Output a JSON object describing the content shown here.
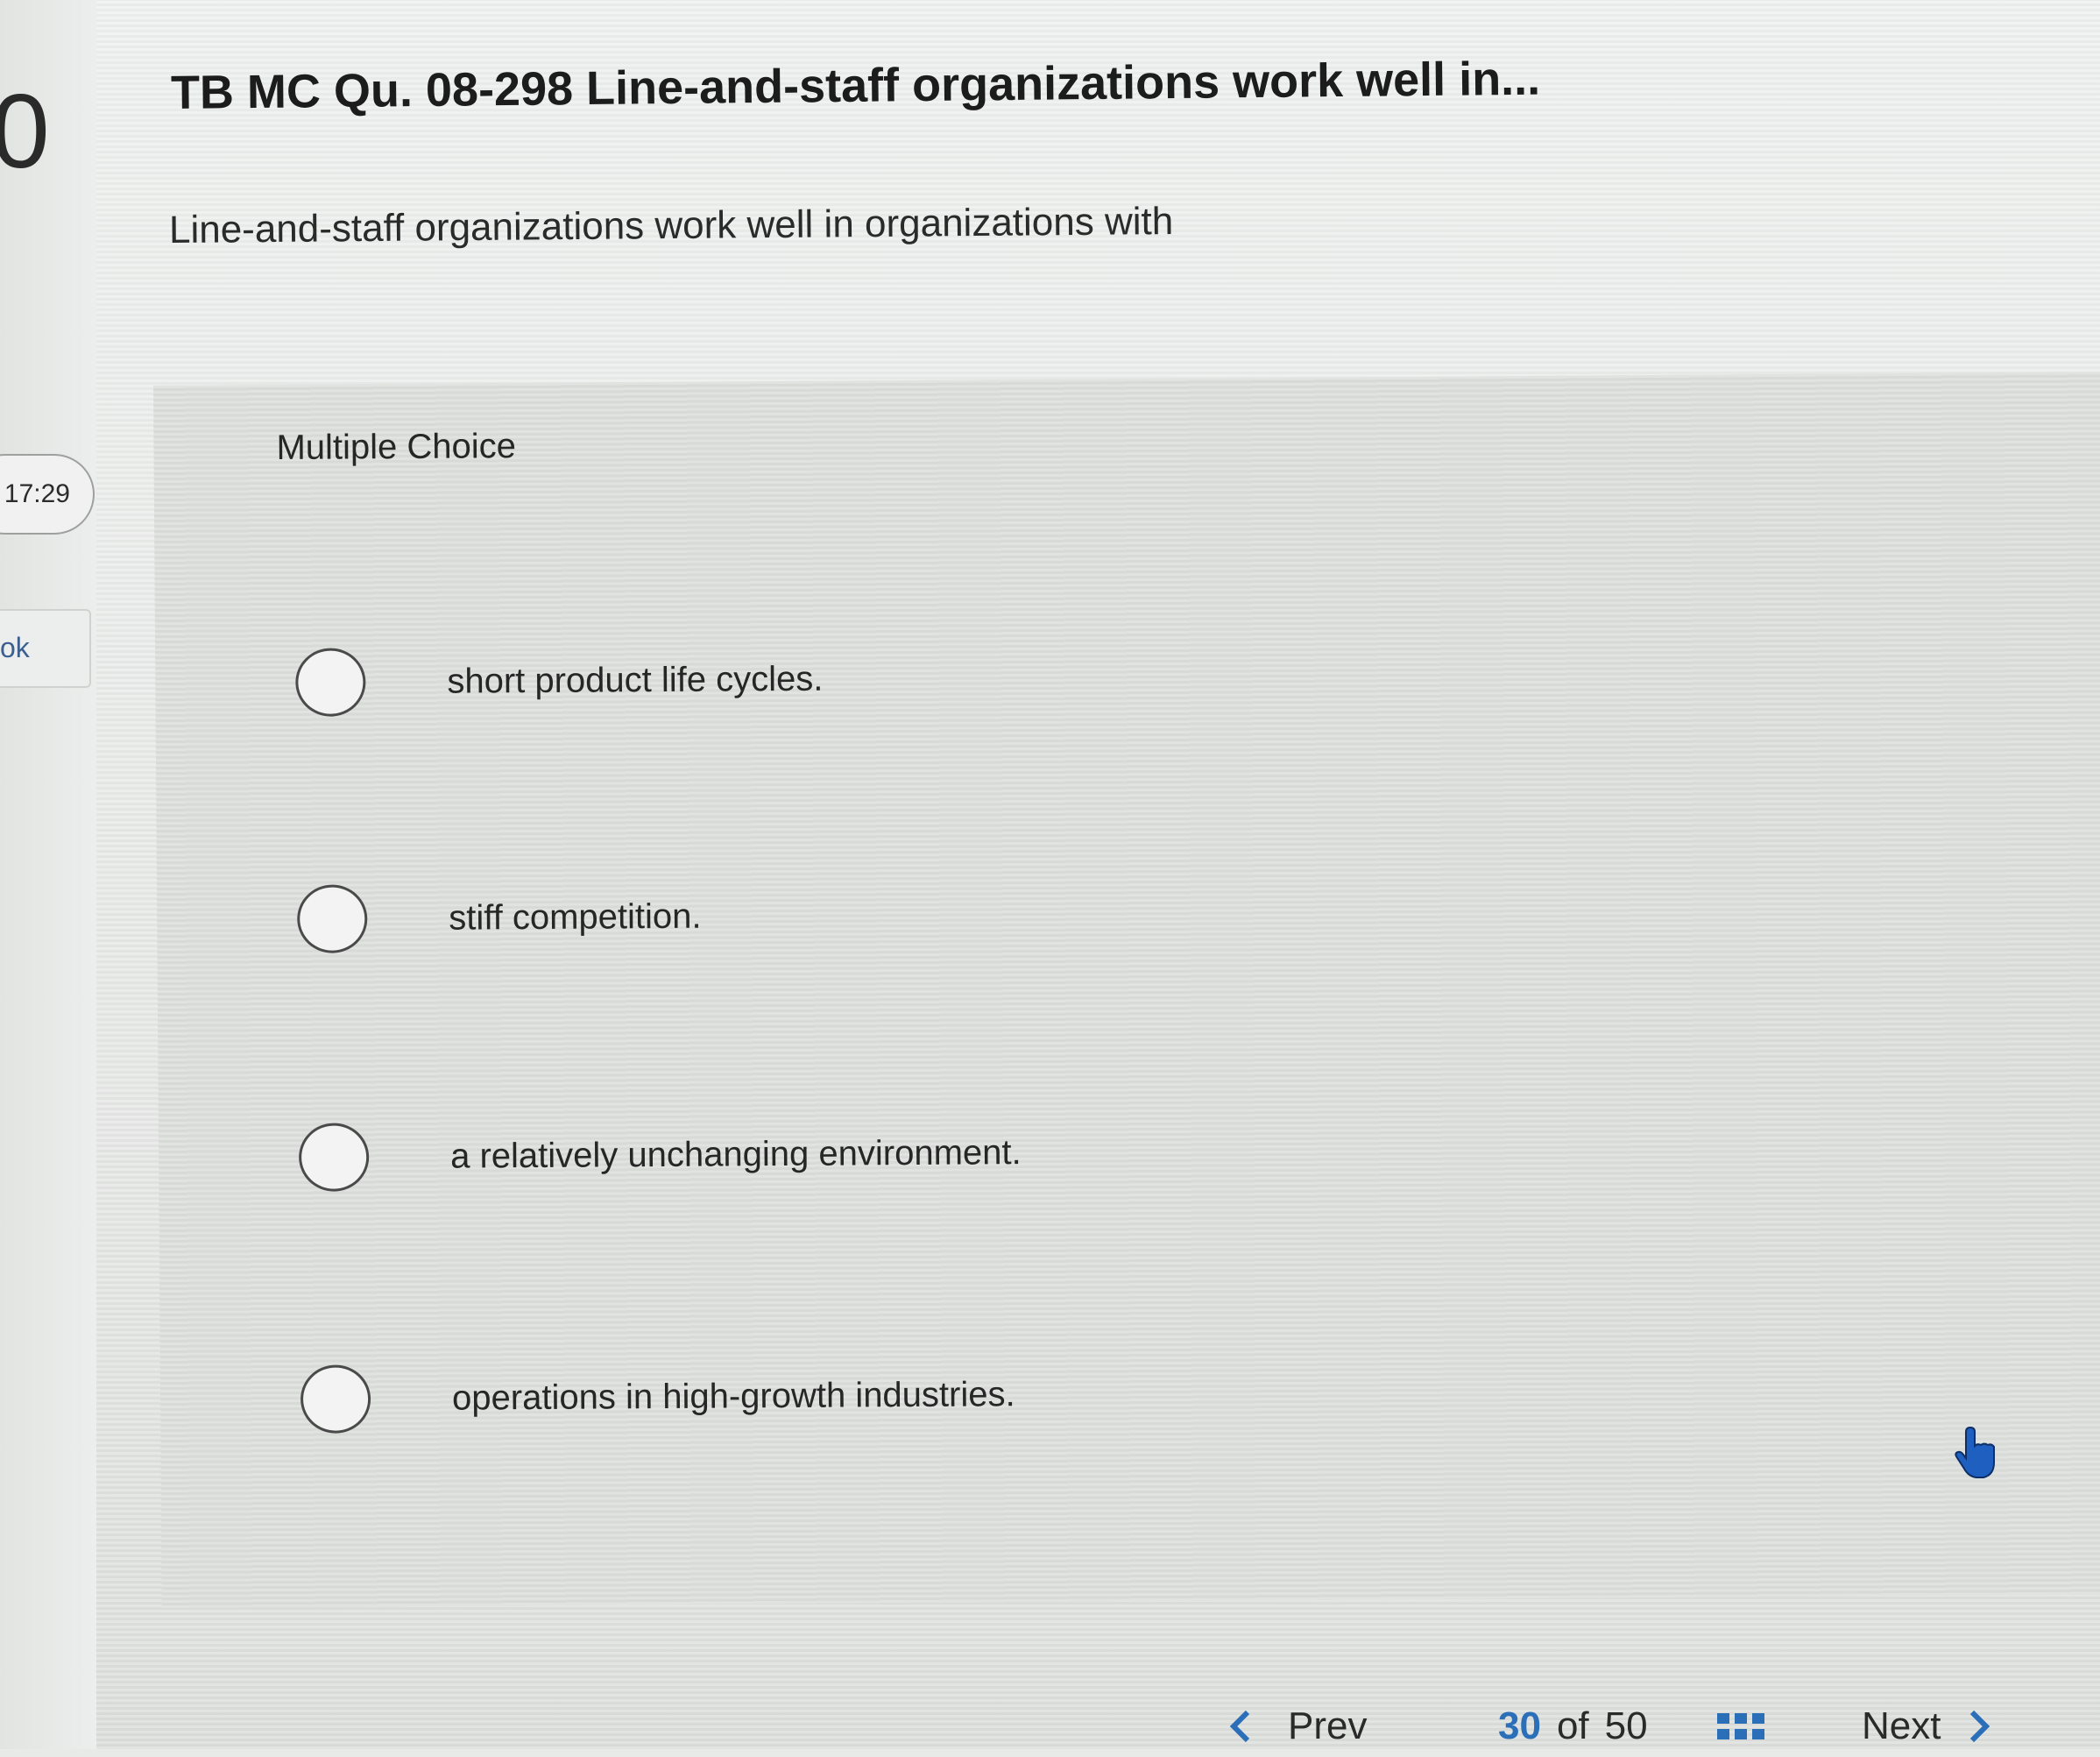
{
  "sidebar": {
    "question_number": "0",
    "timer": "17:29",
    "card_label": "ok"
  },
  "question": {
    "title": "TB MC Qu. 08-298 Line-and-staff organizations work well in...",
    "prompt": "Line-and-staff organizations work well in organizations with"
  },
  "choices": {
    "label": "Multiple Choice",
    "options": [
      {
        "text": "short product life cycles.",
        "selected": false
      },
      {
        "text": "stiff competition.",
        "selected": false
      },
      {
        "text": "a relatively unchanging environment.",
        "selected": false
      },
      {
        "text": "operations in high-growth industries.",
        "selected": false
      }
    ]
  },
  "footer": {
    "prev_label": "Prev",
    "current_page": "30",
    "of_label": "of",
    "total_pages": "50",
    "next_label": "Next"
  },
  "colors": {
    "accent": "#2b6fb8",
    "pointer": "#1f5fbf"
  }
}
